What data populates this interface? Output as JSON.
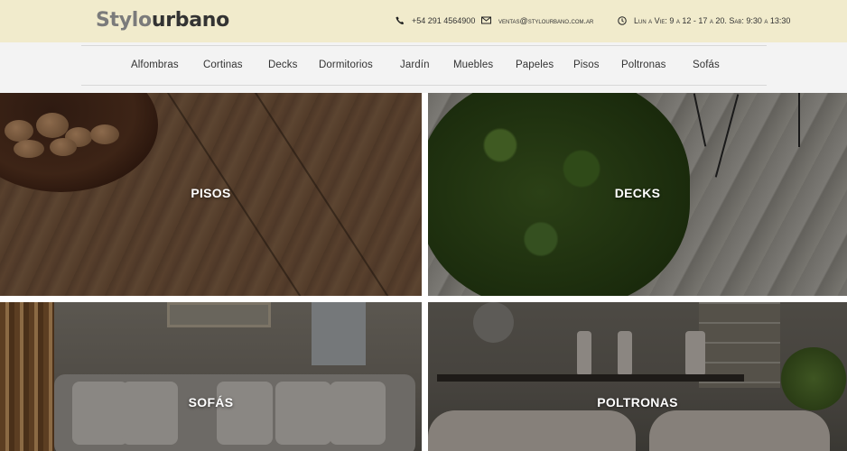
{
  "header": {
    "logo_part1": "Stylo",
    "logo_part2": "urbano",
    "phone": "+54 291 4564900",
    "email": "ventas@stylourbano.com.ar",
    "hours": "Lun a Vie: 9 a 12 - 17 a 20. Sab: 9:30 a 13:30",
    "icons": {
      "phone": "phone-icon",
      "email": "envelope-icon",
      "hours": "clock-icon"
    },
    "colors": {
      "topbar_bg": "#f1ebcc",
      "nav_bg": "#f3f3f3"
    }
  },
  "nav": {
    "items": [
      {
        "label": "Alfombras"
      },
      {
        "label": "Cortinas"
      },
      {
        "label": "Decks"
      },
      {
        "label": "Dormitorios"
      },
      {
        "label": "Jardín"
      },
      {
        "label": "Muebles"
      },
      {
        "label": "Papeles"
      },
      {
        "label": "Pisos"
      },
      {
        "label": "Poltronas"
      },
      {
        "label": "Sofás"
      }
    ]
  },
  "tiles": [
    {
      "label": "PISOS"
    },
    {
      "label": "DECKS"
    },
    {
      "label": "SOFÁS"
    },
    {
      "label": "POLTRONAS"
    }
  ]
}
